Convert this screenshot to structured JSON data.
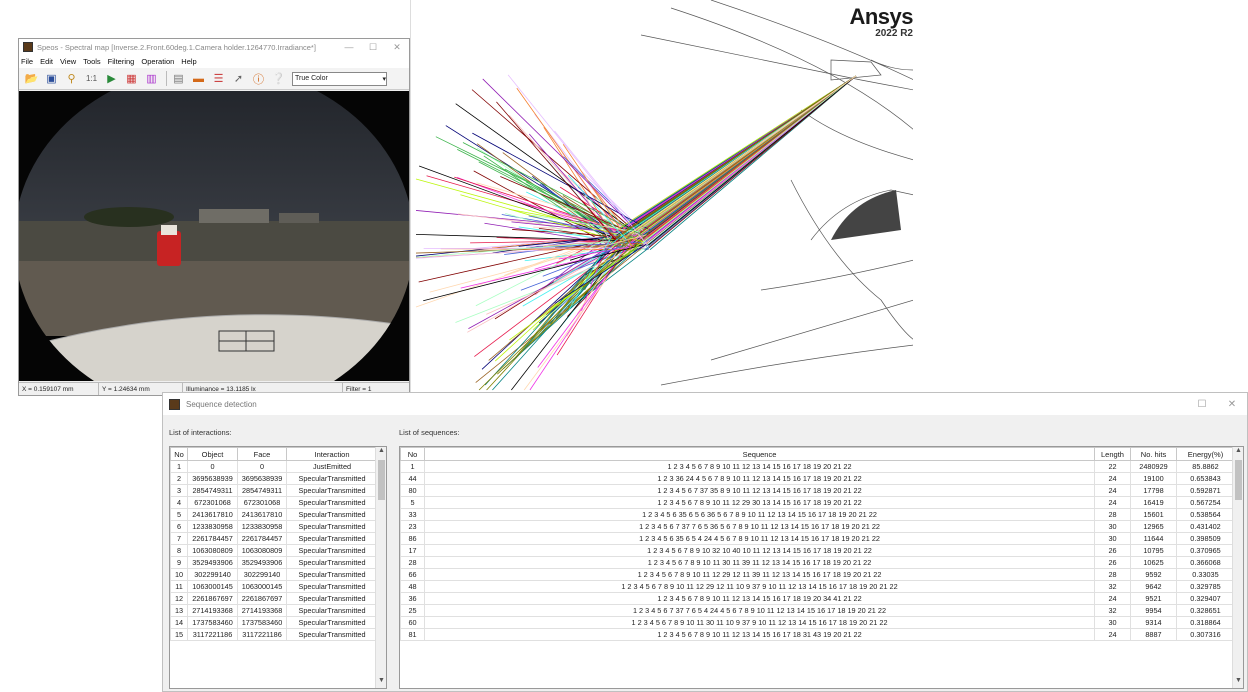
{
  "brand": {
    "name": "Ansys",
    "version": "2022 R2"
  },
  "speos": {
    "title": "Speos - Spectral map [Inverse.2.Front.60deg.1.Camera holder.1264770.Irradiance*]",
    "menu": [
      "File",
      "Edit",
      "View",
      "Tools",
      "Filtering",
      "Operation",
      "Help"
    ],
    "color_mode": "True Color",
    "status": {
      "x": "X = 0.159107 mm",
      "y": "Y = 1.24634 mm",
      "illuminance": "Illuminance = 13.1185 lx",
      "filter": "Filter = 1"
    }
  },
  "sequence_window": {
    "title": "Sequence detection",
    "interactions_label": "List of interactions:",
    "sequences_label": "List of sequences:",
    "interactions_headers": [
      "No",
      "Object",
      "Face",
      "Interaction"
    ],
    "interactions": [
      [
        "1",
        "0",
        "0",
        "JustEmitted"
      ],
      [
        "2",
        "3695638939",
        "3695638939",
        "SpecularTransmitted"
      ],
      [
        "3",
        "2854749311",
        "2854749311",
        "SpecularTransmitted"
      ],
      [
        "4",
        "672301068",
        "672301068",
        "SpecularTransmitted"
      ],
      [
        "5",
        "2413617810",
        "2413617810",
        "SpecularTransmitted"
      ],
      [
        "6",
        "1233830958",
        "1233830958",
        "SpecularTransmitted"
      ],
      [
        "7",
        "2261784457",
        "2261784457",
        "SpecularTransmitted"
      ],
      [
        "8",
        "1063080809",
        "1063080809",
        "SpecularTransmitted"
      ],
      [
        "9",
        "3529493906",
        "3529493906",
        "SpecularTransmitted"
      ],
      [
        "10",
        "302299140",
        "302299140",
        "SpecularTransmitted"
      ],
      [
        "11",
        "1063000145",
        "1063000145",
        "SpecularTransmitted"
      ],
      [
        "12",
        "2261867697",
        "2261867697",
        "SpecularTransmitted"
      ],
      [
        "13",
        "2714193368",
        "2714193368",
        "SpecularTransmitted"
      ],
      [
        "14",
        "1737583460",
        "1737583460",
        "SpecularTransmitted"
      ],
      [
        "15",
        "3117221186",
        "3117221186",
        "SpecularTransmitted"
      ]
    ],
    "sequences_headers": [
      "No",
      "Sequence",
      "Length",
      "No. hits",
      "Energy(%)"
    ],
    "sequences": [
      [
        "1",
        "1 2 3 4 5 6 7 8 9 10 11 12 13 14 15 16 17 18 19 20 21 22",
        "22",
        "2480929",
        "85.8862"
      ],
      [
        "44",
        "1 2 3 36 24 4 5 6 7 8 9 10 11 12 13 14 15 16 17 18 19 20 21 22",
        "24",
        "19100",
        "0.653843"
      ],
      [
        "80",
        "1 2 3 4 5 6 7 37 35 8 9 10 11 12 13 14 15 16 17 18 19 20 21 22",
        "24",
        "17798",
        "0.592871"
      ],
      [
        "5",
        "1 2 3 4 5 6 7 8 9 10 11 12 29 30 13 14 15 16 17 18 19 20 21 22",
        "24",
        "16419",
        "0.567254"
      ],
      [
        "33",
        "1 2 3 4 5 6 35 6 5 6 36 5 6 7 8 9 10 11 12 13 14 15 16 17 18 19 20 21 22",
        "28",
        "15601",
        "0.538564"
      ],
      [
        "23",
        "1 2 3 4 5 6 7 37 7 6 5 36 5 6 7 8 9 10 11 12 13 14 15 16 17 18 19 20 21 22",
        "30",
        "12965",
        "0.431402"
      ],
      [
        "86",
        "1 2 3 4 5 6 35 6 5 4 24 4 5 6 7 8 9 10 11 12 13 14 15 16 17 18 19 20 21 22",
        "30",
        "11644",
        "0.398509"
      ],
      [
        "17",
        "1 2 3 4 5 6 7 8 9 10 32 10 40 10 11 12 13 14 15 16 17 18 19 20 21 22",
        "26",
        "10795",
        "0.370965"
      ],
      [
        "28",
        "1 2 3 4 5 6 7 8 9 10 11 30 11 39 11 12 13 14 15 16 17 18 19 20 21 22",
        "26",
        "10625",
        "0.366068"
      ],
      [
        "66",
        "1 2 3 4 5 6 7 8 9 10 11 12 29 12 11 39 11 12 13 14 15 16 17 18 19 20 21 22",
        "28",
        "9592",
        "0.33035"
      ],
      [
        "48",
        "1 2 3 4 5 6 7 8 9 10 11 12 29 12 11 10 9 37 9 10 11 12 13 14 15 16 17 18 19 20 21 22",
        "32",
        "9642",
        "0.329785"
      ],
      [
        "36",
        "1 2 3 4 5 6 7 8 9 10 11 12 13 14 15 16 17 18 19 20 34 41 21 22",
        "24",
        "9521",
        "0.329407"
      ],
      [
        "25",
        "1 2 3 4 5 6 7 37 7 6 5 4 24 4 5 6 7 8 9 10 11 12 13 14 15 16 17 18 19 20 21 22",
        "32",
        "9954",
        "0.328651"
      ],
      [
        "60",
        "1 2 3 4 5 6 7 8 9 10 11 30 11 10 9 37 9 10 11 12 13 14 15 16 17 18 19 20 21 22",
        "30",
        "9314",
        "0.318864"
      ],
      [
        "81",
        "1 2 3 4 5 6 7 8 9 10 11 12 13 14 15 16 17 18 31 43 19 20 21 22",
        "24",
        "8887",
        "0.307316"
      ]
    ]
  }
}
